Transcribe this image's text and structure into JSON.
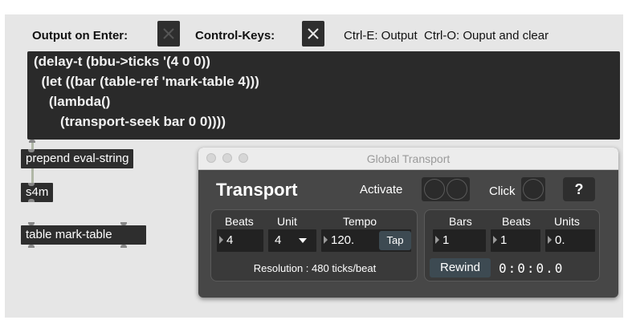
{
  "header": {
    "output_on_enter_label": "Output on Enter:",
    "control_keys_label": "Control-Keys:",
    "shortcuts": "Ctrl-E: Output  Ctrl-O: Ouput and clear"
  },
  "code_editor": {
    "lines": [
      "(delay-t (bbu->ticks '(4 0 0))",
      "  (let ((bar (table-ref 'mark-table 4)))",
      "    (lambda()",
      "       (transport-seek bar 0 0))))"
    ]
  },
  "objects": {
    "prepend": "prepend eval-string",
    "s4m": "s4m",
    "table": "table mark-table"
  },
  "transport": {
    "window_title": "Global Transport",
    "title": "Transport",
    "activate_label": "Activate",
    "click_label": "Click",
    "help_label": "?",
    "left_panel": {
      "beats_header": "Beats",
      "unit_header": "Unit",
      "tempo_header": "Tempo",
      "beats_value": "4",
      "unit_value": "4",
      "tempo_value": "120.",
      "tap_label": "Tap",
      "resolution": "Resolution : 480 ticks/beat"
    },
    "right_panel": {
      "bars_header": "Bars",
      "beats_header": "Beats",
      "units_header": "Units",
      "bars_value": "1",
      "beats_value": "1",
      "units_value": "0.",
      "rewind_label": "Rewind",
      "clock": "0:0:0.0"
    }
  },
  "colors": {
    "object_bg": "#2e2e2e",
    "window_bg": "#474747",
    "button_bg": "#3d4a52"
  }
}
